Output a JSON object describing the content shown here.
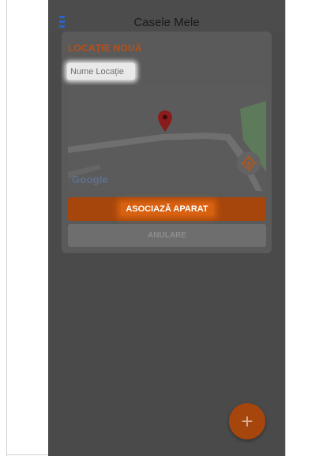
{
  "app_bar": {
    "title": "Casele Mele",
    "menu_icon": "hamburger-menu-icon"
  },
  "dialog": {
    "title": "LOCAȚIE NOUĂ",
    "name_input": {
      "value": "",
      "placeholder": "Nume Locație"
    },
    "map": {
      "attribution": "Google",
      "marker_icon": "map-pin-icon",
      "locate_icon": "my-location-icon"
    },
    "primary_button": "ASOCIAZĂ APARAT",
    "secondary_button": "ANULARE"
  },
  "fab": {
    "label": "+",
    "icon": "plus-icon"
  },
  "colors": {
    "accent": "#c85a14",
    "overlay_background": "#4a4a4a",
    "title_accent": "#b8501a",
    "menu_icon": "#2a63c7"
  }
}
